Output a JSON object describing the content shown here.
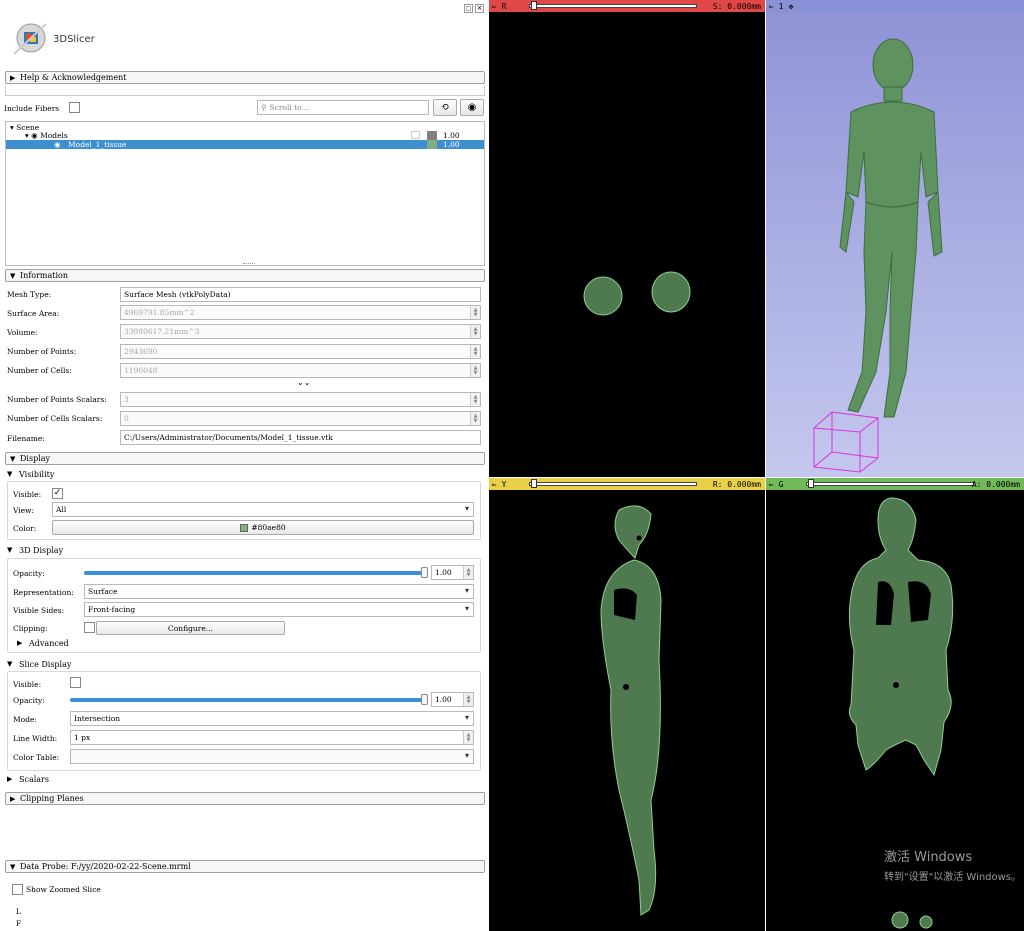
{
  "app": {
    "logo_text": "3DSlicer",
    "help_label": "Help & Acknowledgement"
  },
  "filter": {
    "include_fibers_label": "Include Fibers",
    "search_placeholder": "Scroll to..."
  },
  "tree": {
    "root": "Scene",
    "folder": "Models",
    "folder_opacity": "1.00",
    "item": "Model_1_tissue",
    "item_opacity": "1.00"
  },
  "information": {
    "title": "Information",
    "mesh_type_label": "Mesh Type:",
    "mesh_type": "Surface Mesh (vtkPolyData)",
    "surface_area_label": "Surface Area:",
    "surface_area": "4969791.85mm^2",
    "volume_label": "Volume:",
    "volume": "33980617.21mm^3",
    "num_points_label": "Number of Points:",
    "num_points": "2943690",
    "num_cells_label": "Number of Cells:",
    "num_cells": "1190048",
    "points_scalars_label": "Number of Points Scalars:",
    "points_scalars": "3",
    "cells_scalars_label": "Number of Cells Scalars:",
    "cells_scalars": "0",
    "filename_label": "Filename:",
    "filename": "C:/Users/Administrator/Documents/Model_1_tissue.vtk"
  },
  "display": {
    "title": "Display",
    "visibility_title": "Visibility",
    "visible_label": "Visible:",
    "visible_check": "✓",
    "view_label": "View:",
    "view_value": "All",
    "color_label": "Color:",
    "color_value": "#80ae80",
    "color_hex": "#80ae80"
  },
  "display3d": {
    "title": "3D Display",
    "opacity_label": "Opacity:",
    "opacity": "1.00",
    "representation_label": "Representation:",
    "representation": "Surface",
    "visible_sides_label": "Visible Sides:",
    "visible_sides": "Front-facing",
    "clipping_label": "Clipping:",
    "configure_label": "Configure...",
    "advanced_label": "Advanced"
  },
  "slice_display": {
    "title": "Slice Display",
    "visible_label": "Visible:",
    "opacity_label": "Opacity:",
    "opacity": "1.00",
    "mode_label": "Mode:",
    "mode": "Intersection",
    "line_width_label": "Line Width:",
    "line_width": "1 px",
    "color_table_label": "Color Table:"
  },
  "scalars_label": "Scalars",
  "clipping_planes_label": "Clipping Planes",
  "data_probe": {
    "label": "Data Probe: F:/yy/2020-02-22-Scene.mrml",
    "zoomed_label": "Show Zoomed Slice",
    "l": "L",
    "f": "F"
  },
  "views": {
    "red": {
      "tag": "R",
      "offset": "S: 0.000mm",
      "color": "#e04848"
    },
    "threed": {
      "tag": "1"
    },
    "yellow": {
      "tag": "Y",
      "offset": "R: 0.000mm",
      "color": "#e8d048"
    },
    "green": {
      "tag": "G",
      "offset": "A: 0.000mm",
      "color": "#70b858"
    }
  },
  "watermark": {
    "line1": "激活 Windows",
    "line2": "转到\"设置\"以激活 Windows。"
  }
}
